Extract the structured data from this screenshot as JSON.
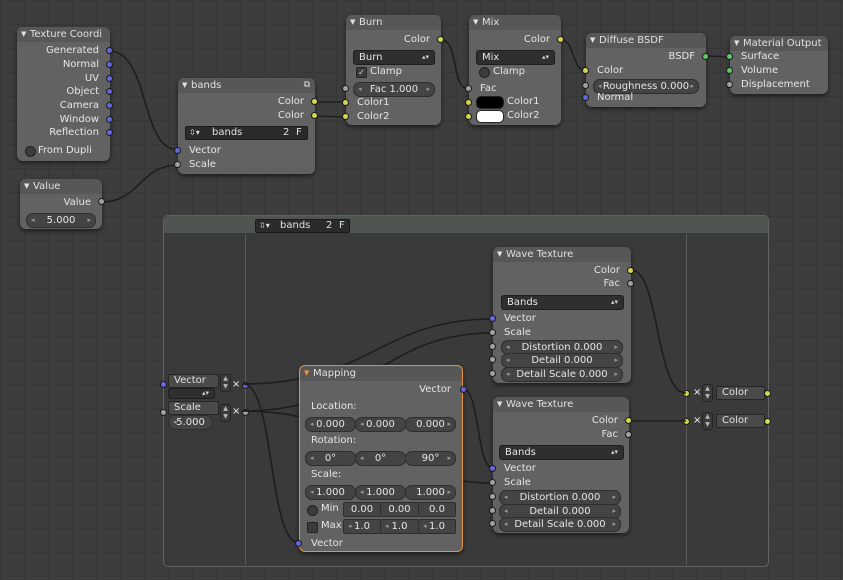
{
  "nodes": {
    "texcoord": {
      "title": "Texture Coordi",
      "outputs": [
        "Generated",
        "Normal",
        "UV",
        "Object",
        "Camera",
        "Window",
        "Reflection"
      ],
      "from_dupli": "From Dupli"
    },
    "value": {
      "title": "Value",
      "output": "Value",
      "field": "5.000"
    },
    "bands_group": {
      "title": "bands",
      "outputs": [
        "Color",
        "Color"
      ],
      "datablock": "bands",
      "users": "2",
      "fake": "F",
      "inputs": [
        "Vector",
        "Scale"
      ]
    },
    "burn": {
      "title": "Burn",
      "output": "Color",
      "mode": "Burn",
      "clamp": "Clamp",
      "fac": "Fac 1.000",
      "inputs": [
        "Color1",
        "Color2"
      ]
    },
    "mix": {
      "title": "Mix",
      "output": "Color",
      "mode": "Mix",
      "clamp": "Clamp",
      "fac": "Fac",
      "inputs": [
        "Color1",
        "Color2"
      ]
    },
    "diffuse": {
      "title": "Diffuse BSDF",
      "output": "BSDF",
      "color": "Color",
      "roughness": "Roughness 0.000",
      "normal": "Normal"
    },
    "matout": {
      "title": "Material Output",
      "inputs": [
        "Surface",
        "Volume",
        "Displacement"
      ]
    }
  },
  "group_edit": {
    "datablock": "bands",
    "users": "2",
    "fake": "F",
    "inputs": [
      {
        "label": "Vector"
      },
      {
        "label": "Scale",
        "value": "5.000"
      }
    ],
    "outputs": [
      "Color",
      "Color"
    ],
    "mapping": {
      "title": "Mapping",
      "output": "Vector",
      "location_label": "Location:",
      "location": [
        "0.000",
        "0.000",
        "0.000"
      ],
      "rotation_label": "Rotation:",
      "rotation": [
        "0°",
        "0°",
        "90°"
      ],
      "scale_label": "Scale:",
      "scale": [
        "1.000",
        "1.000",
        "1.000"
      ],
      "min_label": "Min",
      "min": [
        "0.00",
        "0.00",
        "0.0"
      ],
      "max_label": "Max",
      "max": [
        "1.0",
        "1.0",
        "1.0"
      ],
      "input": "Vector"
    },
    "wave1": {
      "title": "Wave Texture",
      "outputs": [
        "Color",
        "Fac"
      ],
      "type": "Bands",
      "inputs": [
        "Vector",
        "Scale"
      ],
      "distortion": "Distortion 0.000",
      "detail": "Detail 0.000",
      "detail_scale": "Detail Scale 0.000"
    },
    "wave2": {
      "title": "Wave Texture",
      "outputs": [
        "Color",
        "Fac"
      ],
      "type": "Bands",
      "inputs": [
        "Vector",
        "Scale"
      ],
      "distortion": "Distortion 0.000",
      "detail": "Detail 0.000",
      "detail_scale": "Detail Scale 0.000"
    }
  },
  "colors": {
    "socket_color": "#d6d64a",
    "socket_value": "#a1a1a1",
    "socket_vector": "#6565e0",
    "socket_shader": "#63c763",
    "wire": "#1e1e1e",
    "active_border": "#e8952e"
  }
}
